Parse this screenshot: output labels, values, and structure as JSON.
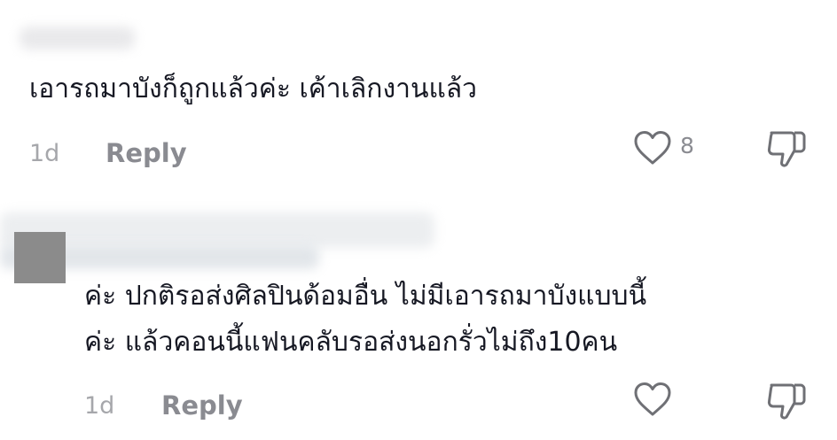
{
  "comments": [
    {
      "text": "เอารถมาบังก็ถูกแล้วค่ะ เค้าเลิกงานแล้ว",
      "time": "1d",
      "reply_label": "Reply",
      "like_count": "8",
      "like_icon": "heart-icon",
      "dislike_icon": "thumbs-down-icon"
    },
    {
      "text_lines": [
        "ค่ะ ปกติรอส่งศิลปินด้อมอื่น ไม่มีเอารถมาบังแบบนี้",
        "ค่ะ แล้วคอนนี้แฟนคลับรอส่งนอกรั่วไม่ถึง10คน"
      ],
      "time": "1d",
      "reply_label": "Reply",
      "like_icon": "heart-icon",
      "dislike_icon": "thumbs-down-icon"
    }
  ],
  "colors": {
    "text": "#161823",
    "muted": "#8a8b91",
    "time": "#a6a7ab",
    "icon": "#6f7075",
    "avatar": "#8b8b8b"
  }
}
